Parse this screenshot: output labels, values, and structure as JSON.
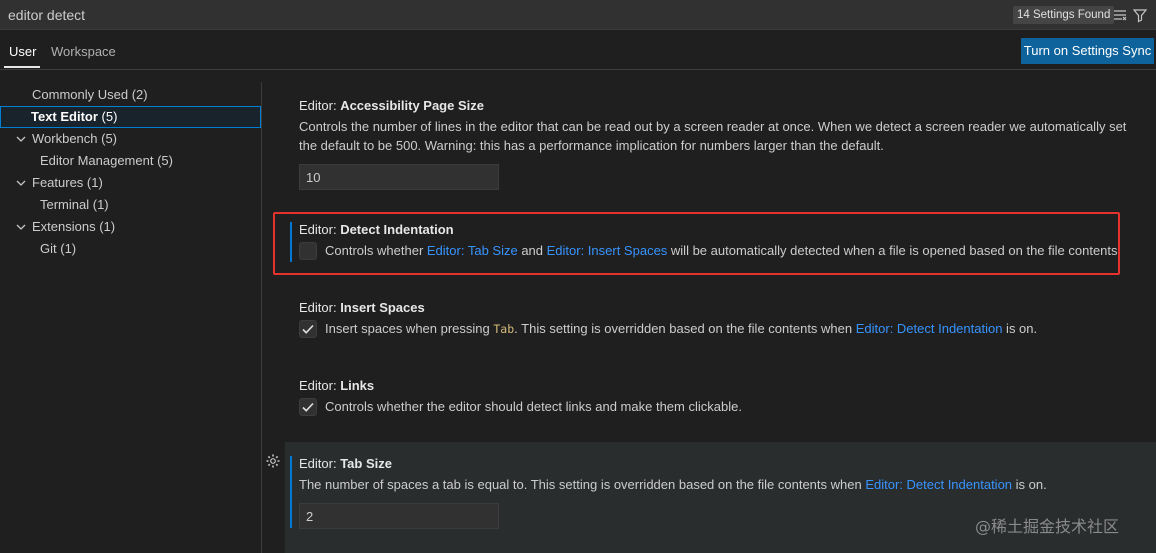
{
  "search": {
    "value": "editor detect",
    "result_count": "14 Settings Found"
  },
  "tabs": [
    {
      "label": "User"
    },
    {
      "label": "Workspace"
    }
  ],
  "sync_button": "Turn on Settings Sync",
  "toc": [
    {
      "label": "Commonly Used",
      "count": " (2)"
    },
    {
      "label": "Text Editor",
      "count": " (5)"
    },
    {
      "label": "Workbench",
      "count": " (5)"
    },
    {
      "label": "Editor Management",
      "count": " (5)"
    },
    {
      "label": "Features",
      "count": " (1)"
    },
    {
      "label": "Terminal",
      "count": " (1)"
    },
    {
      "label": "Extensions",
      "count": " (1)"
    },
    {
      "label": "Git",
      "count": " (1)"
    }
  ],
  "settings": {
    "page_size": {
      "category": "Editor: ",
      "name": "Accessibility Page Size",
      "desc_line1": "Controls the number of lines in the editor that can be read out by a screen reader at once. When we detect a screen reader we automatically set",
      "desc_line2": "the default to be 500. Warning: this has a performance implication for numbers larger than the default.",
      "value": "10"
    },
    "detect_indentation": {
      "category": "Editor: ",
      "name": "Detect Indentation",
      "desc_a": "Controls whether ",
      "link1": "Editor: Tab Size",
      "desc_b": " and ",
      "link2": "Editor: Insert Spaces",
      "desc_c": " will be automatically detected when a file is opened based on the file contents."
    },
    "insert_spaces": {
      "category": "Editor: ",
      "name": "Insert Spaces",
      "desc_a": "Insert spaces when pressing ",
      "code": "Tab",
      "desc_b": ". This setting is overridden based on the file contents when ",
      "link": "Editor: Detect Indentation",
      "desc_c": " is on."
    },
    "links": {
      "category": "Editor: ",
      "name": "Links",
      "desc": "Controls whether the editor should detect links and make them clickable."
    },
    "tab_size": {
      "category": "Editor: ",
      "name": "Tab Size",
      "desc_a": "The number of spaces a tab is equal to. This setting is overridden based on the file contents when ",
      "link": "Editor: Detect Indentation",
      "desc_b": " is on.",
      "value": "2"
    }
  },
  "watermark": "@稀土掘金技术社区",
  "colors": {
    "accent": "#0078d4",
    "link": "#3794ff",
    "highlight": "#e5322d"
  }
}
